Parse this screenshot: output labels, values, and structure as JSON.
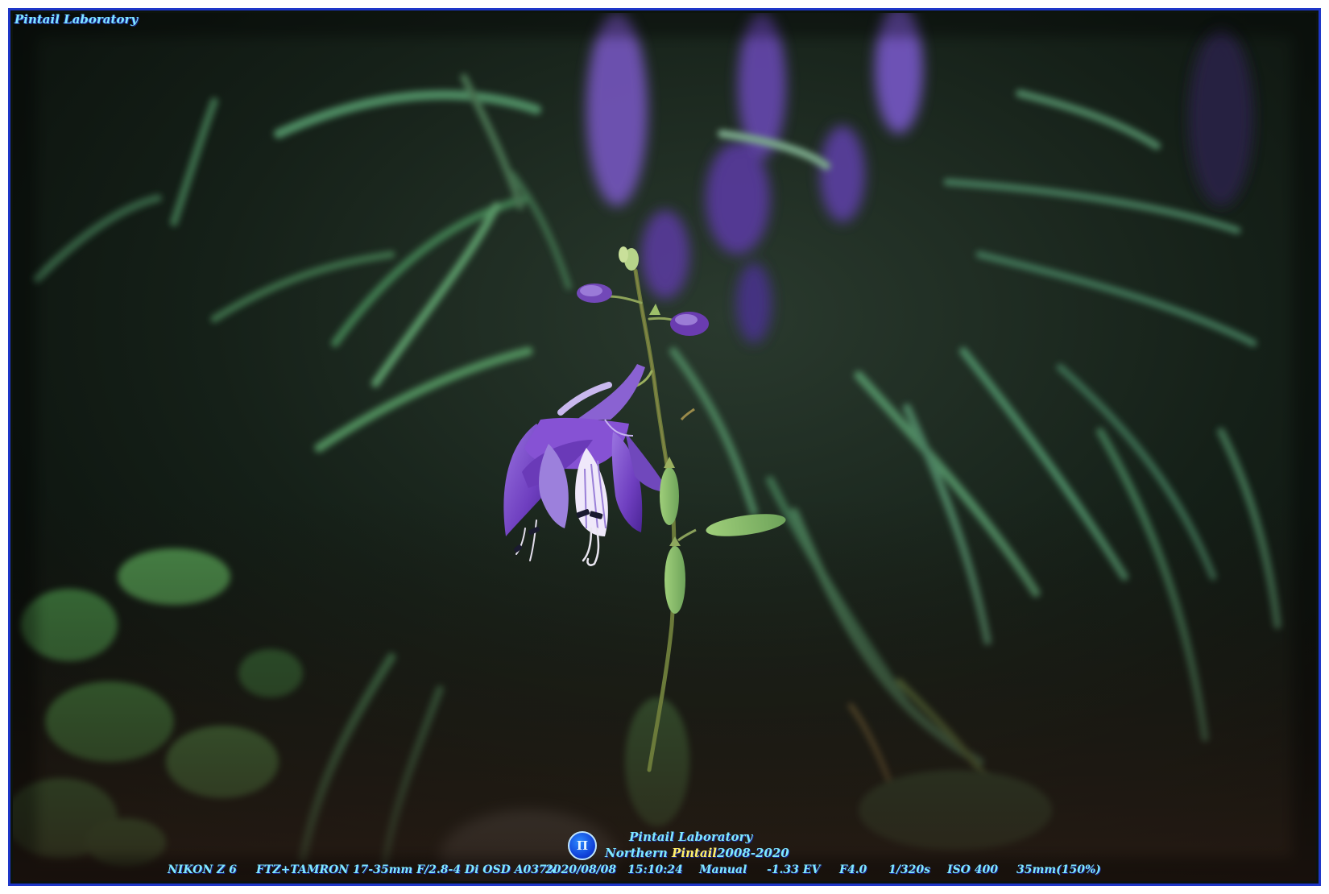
{
  "watermark": {
    "top_left": "Pintail Laboratory",
    "logo_glyph": "Π",
    "logo_line1": "Pintail Laboratory",
    "logo_line2_a": "Northern",
    "logo_line2_b": "Pintail",
    "logo_line2_c": "2008-2020"
  },
  "exif": {
    "camera": "NIKON Z 6",
    "lens": "FTZ+TAMRON 17-35mm F/2.8-4 Di OSD A037N",
    "date": "2020/08/08",
    "time": "15:10:24",
    "mode": "Manual",
    "ev": "-1.33 EV",
    "aperture": "F4.0",
    "shutter": "1/320s",
    "iso": "ISO 400",
    "focal": "35mm(150%)"
  },
  "colors": {
    "frame_border": "#1e36c8",
    "watermark_cyan": "#7fe8ff",
    "watermark_yellow": "#ffef6a",
    "flower_purple": "#7a4cc6",
    "foliage_green": "#3f7a4a"
  }
}
